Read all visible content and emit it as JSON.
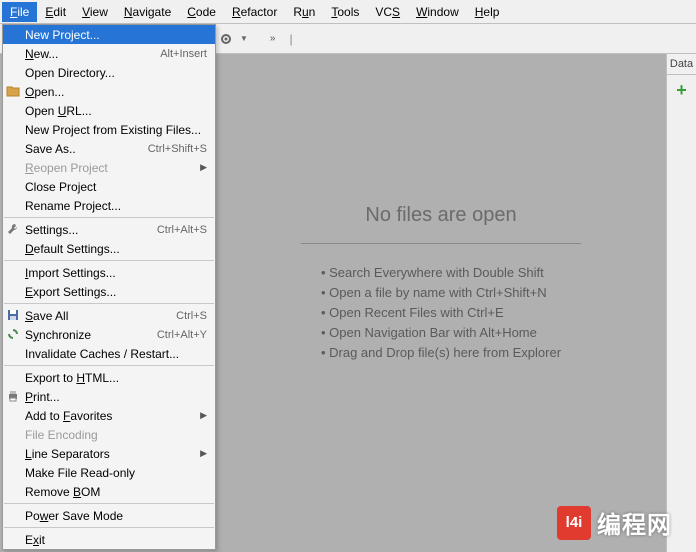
{
  "menubar": [
    "File",
    "Edit",
    "View",
    "Navigate",
    "Code",
    "Refactor",
    "Run",
    "Tools",
    "VCS",
    "Window",
    "Help"
  ],
  "menubar_mnemonic": [
    "F",
    "E",
    "V",
    "N",
    "C",
    "R",
    "u",
    "T",
    "S",
    "W",
    "H"
  ],
  "dropdown": {
    "items": [
      {
        "label": "New Project...",
        "mn": "",
        "hl": true
      },
      {
        "label": "New...",
        "mn": "N",
        "shortcut": "Alt+Insert"
      },
      {
        "label": "Open Directory...",
        "mn": ""
      },
      {
        "label": "Open...",
        "mn": "O",
        "icon": "folder"
      },
      {
        "label": "Open URL...",
        "mn": "U"
      },
      {
        "label": "New Project from Existing Files...",
        "mn": ""
      },
      {
        "label": "Save As..",
        "mn": "",
        "shortcut": "Ctrl+Shift+S"
      },
      {
        "label": "Reopen Project",
        "mn": "R",
        "disabled": true,
        "arrow": true
      },
      {
        "label": "Close Project",
        "mn": "j"
      },
      {
        "label": "Rename Project...",
        "mn": ""
      },
      {
        "sep": true
      },
      {
        "label": "Settings...",
        "mn": "",
        "shortcut": "Ctrl+Alt+S",
        "icon": "wrench"
      },
      {
        "label": "Default Settings...",
        "mn": "D"
      },
      {
        "sep": true
      },
      {
        "label": "Import Settings...",
        "mn": "I"
      },
      {
        "label": "Export Settings...",
        "mn": "E"
      },
      {
        "sep": true
      },
      {
        "label": "Save All",
        "mn": "S",
        "shortcut": "Ctrl+S",
        "icon": "save"
      },
      {
        "label": "Synchronize",
        "mn": "y",
        "shortcut": "Ctrl+Alt+Y",
        "icon": "sync"
      },
      {
        "label": "Invalidate Caches / Restart...",
        "mn": ""
      },
      {
        "sep": true
      },
      {
        "label": "Export to HTML...",
        "mn": "H"
      },
      {
        "label": "Print...",
        "mn": "P",
        "icon": "print"
      },
      {
        "label": "Add to Favorites",
        "mn": "F",
        "arrow": true
      },
      {
        "label": "File Encoding",
        "mn": "",
        "disabled": true
      },
      {
        "label": "Line Separators",
        "mn": "L",
        "arrow": true
      },
      {
        "label": "Make File Read-only",
        "mn": ""
      },
      {
        "label": "Remove BOM",
        "mn": "B"
      },
      {
        "sep": true
      },
      {
        "label": "Power Save Mode",
        "mn": "w"
      },
      {
        "sep": true
      },
      {
        "label": "Exit",
        "mn": "x"
      }
    ]
  },
  "main": {
    "title": "No files are open",
    "tips": [
      "Search Everywhere with Double Shift",
      "Open a file by name with Ctrl+Shift+N",
      "Open Recent Files with Ctrl+E",
      "Open Navigation Bar with Alt+Home",
      "Drag and Drop file(s) here from Explorer"
    ]
  },
  "right": {
    "tab": "Data",
    "plus": "+"
  },
  "watermark": {
    "badge": "l4i",
    "text": "编程网"
  }
}
